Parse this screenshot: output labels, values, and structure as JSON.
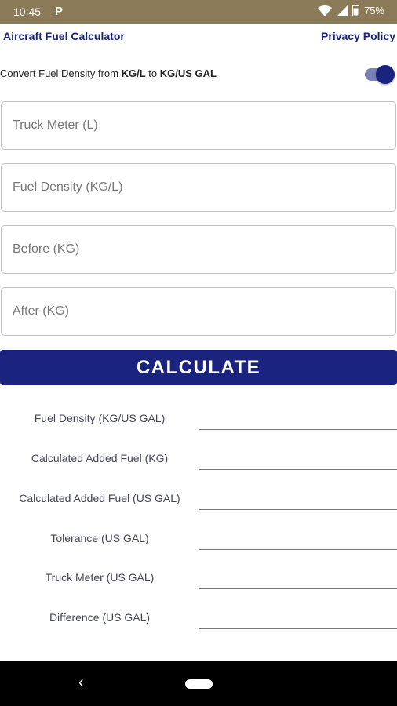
{
  "status": {
    "time": "10:45",
    "app_icon": "P",
    "battery": "75%"
  },
  "header": {
    "title": "Aircraft Fuel Calculator",
    "privacy": "Privacy Policy"
  },
  "convert": {
    "prefix": "Convert Fuel Density from ",
    "from": "KG/L",
    "mid": " to ",
    "to": "KG/US GAL",
    "toggle_on": true
  },
  "fields": {
    "truck_meter": {
      "placeholder": "Truck Meter (L)",
      "value": ""
    },
    "fuel_density": {
      "placeholder": "Fuel Density (KG/L)",
      "value": ""
    },
    "before": {
      "placeholder": "Before (KG)",
      "value": ""
    },
    "after": {
      "placeholder": "After (KG)",
      "value": ""
    }
  },
  "calculate_label": "CALCULATE",
  "results": [
    {
      "label": "Fuel Density (KG/US GAL)",
      "value": ""
    },
    {
      "label": "Calculated Added Fuel (KG)",
      "value": ""
    },
    {
      "label": "Calculated Added Fuel (US GAL)",
      "value": ""
    },
    {
      "label": "Tolerance (US GAL)",
      "value": ""
    },
    {
      "label": "Truck Meter (US GAL)",
      "value": ""
    },
    {
      "label": "Difference (US GAL)",
      "value": ""
    }
  ],
  "nav": {
    "back_glyph": "‹"
  },
  "colors": {
    "primary": "#1a237e",
    "status_bar": "#8a7a57",
    "toggle_track": "#7b82b8"
  }
}
